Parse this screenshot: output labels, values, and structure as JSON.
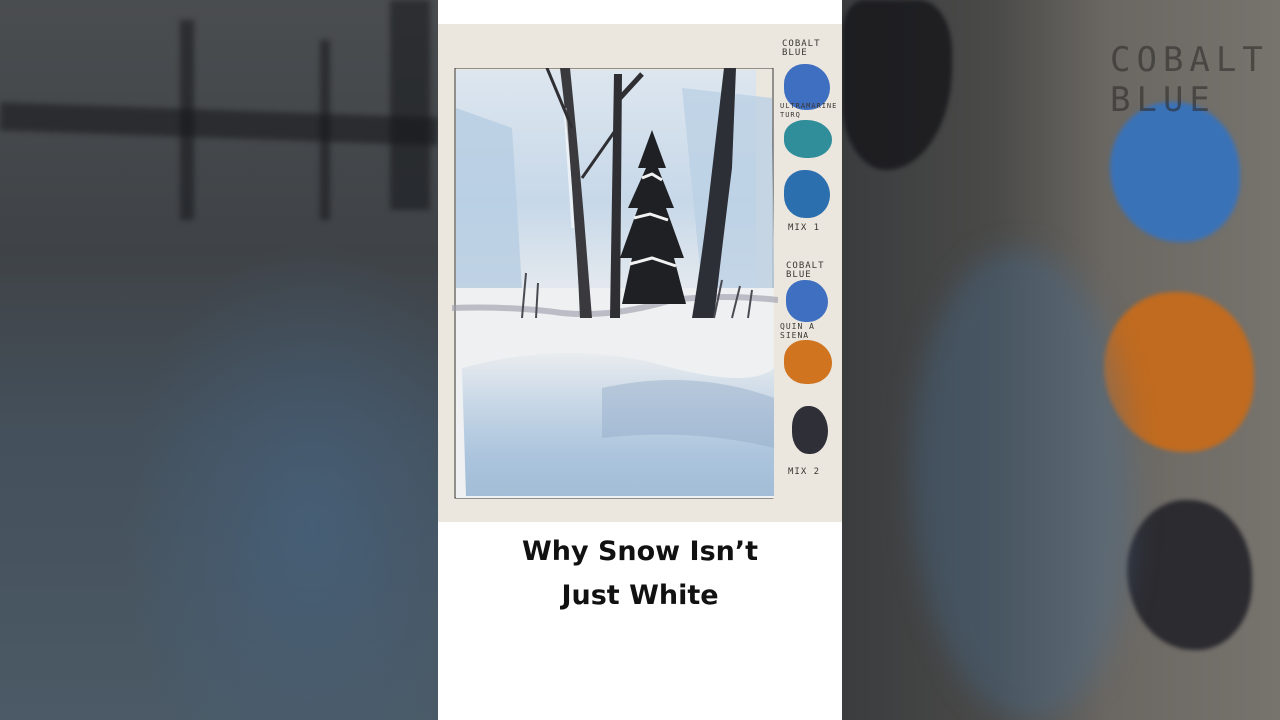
{
  "caption": {
    "line1": "Why Snow Isn’t",
    "line2": "Just White"
  },
  "swatch_labels": {
    "cobalt_blue_1": "COBALT\nBLUE",
    "ultramarine_turq": "ULTRAMARINE\nTURQ",
    "mix_1": "MIX 1",
    "cobalt_blue_2": "COBALT\nBLUE",
    "quina_siena": "QUIN A\nSIENA",
    "mix_2": "MIX 2"
  },
  "colors": {
    "cobalt_blue": "#3f6fc0",
    "ultramarine_turquoise": "#2f8e9a",
    "mix_1": "#2c6fae",
    "quinacridone_sienna": "#d0741f",
    "mix_2": "#2f2f38",
    "snow_shadow": "#9fbad6",
    "paper": "#ebe7df"
  }
}
